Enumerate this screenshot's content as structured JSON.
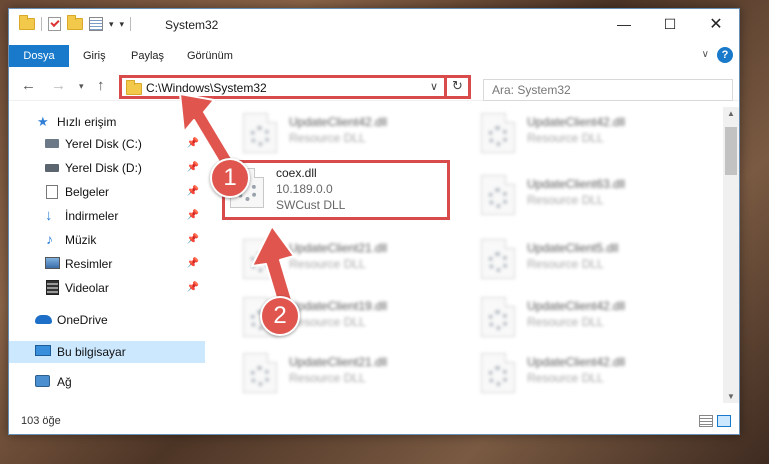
{
  "window": {
    "title": "System32",
    "controls": {
      "minimize": "—",
      "maximize": "☐",
      "close": "✕"
    }
  },
  "ribbon": {
    "tabs": [
      "Dosya",
      "Giriş",
      "Paylaş",
      "Görünüm"
    ],
    "help": "?"
  },
  "navigation": {
    "address": "C:\\Windows\\System32",
    "search_placeholder": "Ara: System32"
  },
  "sidebar": {
    "items": [
      {
        "label": "Hızlı erişim",
        "icon": "star-icon",
        "pinned": false
      },
      {
        "label": "Yerel Disk (C:)",
        "icon": "drive-icon",
        "pinned": true
      },
      {
        "label": "Yerel Disk (D:)",
        "icon": "drive-icon",
        "pinned": true
      },
      {
        "label": "Belgeler",
        "icon": "documents-icon",
        "pinned": true
      },
      {
        "label": "İndirmeler",
        "icon": "download-icon",
        "pinned": true
      },
      {
        "label": "Müzik",
        "icon": "music-icon",
        "pinned": true
      },
      {
        "label": "Resimler",
        "icon": "pictures-icon",
        "pinned": true
      },
      {
        "label": "Videolar",
        "icon": "video-icon",
        "pinned": true
      },
      {
        "label": "OneDrive",
        "icon": "cloud-icon",
        "pinned": false
      },
      {
        "label": "Bu bilgisayar",
        "icon": "computer-icon",
        "pinned": false,
        "selected": true
      },
      {
        "label": "Ağ",
        "icon": "network-icon",
        "pinned": false
      }
    ]
  },
  "files": {
    "left_column": [
      {
        "name": "UpdateClient42.dll",
        "type": "Resource DLL"
      },
      {
        "name": "coex.dll",
        "version": "10.189.0.0",
        "description": "SWCust DLL",
        "highlighted": true
      },
      {
        "name": "UpdateClient21.dll",
        "type": "Resource DLL"
      },
      {
        "name": "UpdateClient19.dll",
        "type": "Resource DLL"
      },
      {
        "name": "UpdateClient21.dll",
        "type": "Resource DLL"
      }
    ],
    "right_column": [
      {
        "name": "UpdateClient42.dll",
        "type": "Resource DLL"
      },
      {
        "name": "UpdateClient63.dll",
        "type": "Resource DLL"
      },
      {
        "name": "UpdateClient5.dll",
        "type": "Resource DLL"
      },
      {
        "name": "UpdateClient42.dll",
        "type": "Resource DLL"
      },
      {
        "name": "UpdateClient42.dll",
        "type": "Resource DLL"
      }
    ]
  },
  "status": {
    "item_count": "103 öğe"
  },
  "annotations": {
    "step1": "1",
    "step2": "2",
    "color": "#e0564f"
  }
}
